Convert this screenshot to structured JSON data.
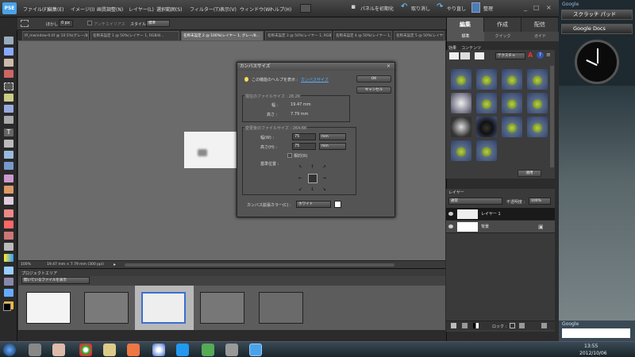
{
  "app": {
    "logo": "PSE"
  },
  "menu": {
    "items": [
      "ファイル(F)",
      "編集(E)",
      "イメージ(I)",
      "画質調整(N)",
      "レイヤー(L)",
      "選択範囲(S)",
      "フィルター(T)",
      "表示(V)",
      "ウィンドウ(W)",
      "ヘルプ(H)"
    ],
    "share": "パネルを初期化",
    "undo": "取り消し",
    "redo": "やり直し",
    "organize": "整理"
  },
  "options": {
    "feather_label": "ぼかし :",
    "feather_value": "0 px",
    "antialias": "アンチエイリアス",
    "style_label": "スタイル:",
    "style_value": "標準"
  },
  "doc_tabs": [
    "IP_mwindow-0.tif @ 10.5%(グレー/8...",
    "名称未設定 1 @ 50%(レイヤー 1, RGB/8...",
    "名称未設定 2 @ 100%(レイヤー 1, グレー/8...",
    "名称未設定 3 @ 50%(レイヤー 1, RGB/8...",
    "名称未設定 4 @ 50%(レイヤー 1, RGB/8...",
    "名称未設定 5 @ 50%(レイヤー 1, RGB/8..."
  ],
  "status": {
    "zoom": "100%",
    "size": "19.47 mm × 7.79 mm (300 ppi)"
  },
  "project": {
    "title": "プロジェクトエリア",
    "dropdown": "開いているファイルを表示"
  },
  "dialog": {
    "title": "カンバスサイズ",
    "help_text": "この機能のヘルプを表示 :",
    "help_link": "カンバスサイズ",
    "ok": "OK",
    "cancel": "キャンセル",
    "current_label": "現在のファイルサイズ : 28.2K",
    "width_label": "幅 :",
    "width_value": "19.47 mm",
    "height_label": "高さ :",
    "height_value": "7.79 mm",
    "new_label": "変更後のファイルサイズ : 264.6K",
    "new_width_label": "幅(W) :",
    "new_width_value": "75",
    "new_height_label": "高さ(H) :",
    "new_height_value": "75",
    "unit": "mm",
    "relative": "相対(R)",
    "anchor": "基準位置 :",
    "ext_color_label": "カンバス拡張カラー(C) :",
    "ext_color_value": "ホワイト"
  },
  "right": {
    "tabs": [
      "編集",
      "作成",
      "配信"
    ],
    "subtabs": [
      "標準",
      "クイック",
      "ガイド"
    ],
    "effects_tabs": [
      "効果",
      "コンテンツ"
    ],
    "effects_dropdown": "テクスチャ",
    "apply": "適用",
    "layers_title": "レイヤー",
    "blend_mode": "通常",
    "opacity_label": "不透明度 :",
    "opacity": "100%",
    "layers": [
      "レイヤー 1",
      "背景"
    ],
    "lock_label": "ロック :"
  },
  "sidebar": {
    "brand": "Google",
    "scratchpad": "スクラッチ パッド",
    "docs": "Google Docs",
    "search_brand": "Google"
  },
  "taskbar": {
    "time": "13:55",
    "date": "2012/10/06"
  },
  "colors": {
    "accent": "#4aa3e8",
    "sidebar": "#1f2a30",
    "panel": "#2c2c2c"
  }
}
